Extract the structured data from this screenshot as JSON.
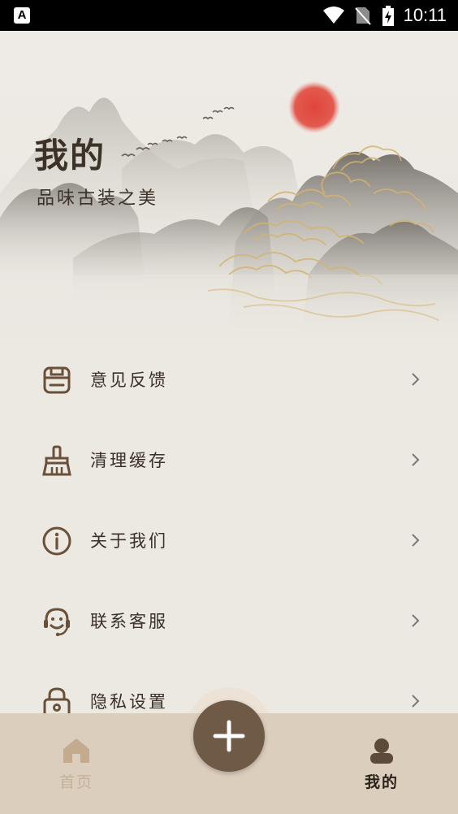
{
  "status_bar": {
    "time": "10:11",
    "app_icon": "A"
  },
  "header": {
    "title": "我的",
    "subtitle": "品味古装之美"
  },
  "menu": {
    "items": [
      {
        "label": "意见反馈",
        "icon": "feedback-icon"
      },
      {
        "label": "清理缓存",
        "icon": "broom-icon"
      },
      {
        "label": "关于我们",
        "icon": "info-icon"
      },
      {
        "label": "联系客服",
        "icon": "customer-service-icon"
      },
      {
        "label": "隐私设置",
        "icon": "lock-icon"
      }
    ]
  },
  "tabbar": {
    "home_label": "首页",
    "mine_label": "我的",
    "active_tab": "mine",
    "add_icon": "plus-icon"
  },
  "colors": {
    "background": "#ece8e2",
    "accent": "#6e5a45",
    "tabbar": "#dccebd",
    "sun": "#e0453a",
    "gold_cloud": "#d4b36e"
  }
}
